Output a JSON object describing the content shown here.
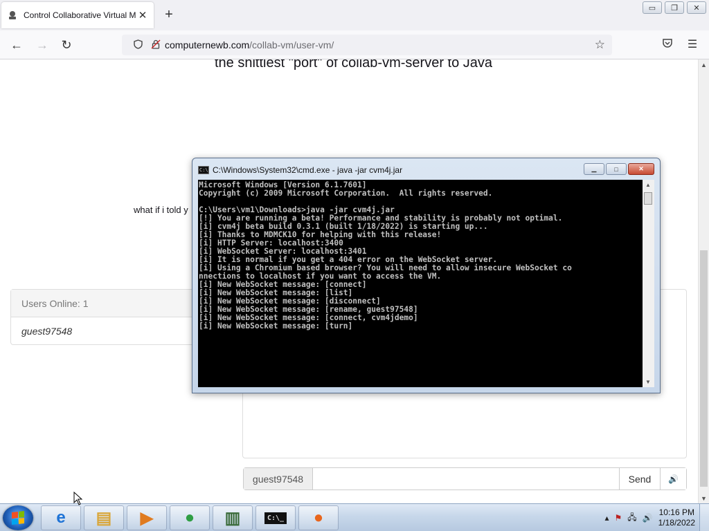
{
  "browser": {
    "tab_title": "Control Collaborative Virtual M",
    "tab_close_glyph": "✕",
    "new_tab_glyph": "+",
    "url_host": "computernewb.com",
    "url_path": "/collab-vm/user-vm/",
    "window_buttons": {
      "minimize": "▭",
      "restore": "❐",
      "close": "✕"
    }
  },
  "page": {
    "heading": "the shittiest \"port\" of collab-vm-server to Java",
    "side_text": "what if i told y",
    "users": {
      "header": "Users Online: 1",
      "list": [
        "guest97548"
      ]
    },
    "chat": {
      "username": "guest97548",
      "input_value": "",
      "send_label": "Send",
      "volume_icon": "🔊"
    }
  },
  "cmd": {
    "title": "C:\\Windows\\System32\\cmd.exe - java  -jar cvm4j.jar",
    "lines": [
      "Microsoft Windows [Version 6.1.7601]",
      "Copyright (c) 2009 Microsoft Corporation.  All rights reserved.",
      "",
      "C:\\Users\\vm1\\Downloads>java -jar cvm4j.jar",
      "[!] You are running a beta! Performance and stability is probably not optimal.",
      "[i] cvm4j beta build 0.3.1 (built 1/18/2022) is starting up...",
      "[i] Thanks to MDMCK10 for helping with this release!",
      "[i] HTTP Server: localhost:3400",
      "[i] WebSocket Server: localhost:3401",
      "[i] It is normal if you get a 404 error on the WebSocket server.",
      "[i] Using a Chromium based browser? You will need to allow insecure WebSocket co",
      "nnections to localhost if you want to access the VM.",
      "[i] New WebSocket message: [connect]",
      "[i] New WebSocket message: [list]",
      "[i] New WebSocket message: [disconnect]",
      "[i] New WebSocket message: [rename, guest97548]",
      "[i] New WebSocket message: [connect, cvm4jdemo]",
      "[i] New WebSocket message: [turn]"
    ]
  },
  "taskbar": {
    "items": [
      {
        "name": "internet-explorer",
        "glyph": "e",
        "color": "#1e73d6"
      },
      {
        "name": "file-explorer",
        "glyph": "▤",
        "color": "#d9a63a"
      },
      {
        "name": "media-player",
        "glyph": "▶",
        "color": "#e07b1f"
      },
      {
        "name": "chrome",
        "glyph": "●",
        "color": "#2f9e44"
      },
      {
        "name": "task-manager",
        "glyph": "▥",
        "color": "#3a6b3a"
      },
      {
        "name": "command-prompt",
        "glyph": "C:\\_",
        "color": "#111111"
      },
      {
        "name": "firefox",
        "glyph": "●",
        "color": "#e8661d"
      }
    ],
    "clock_time": "10:16 PM",
    "clock_date": "1/18/2022"
  }
}
